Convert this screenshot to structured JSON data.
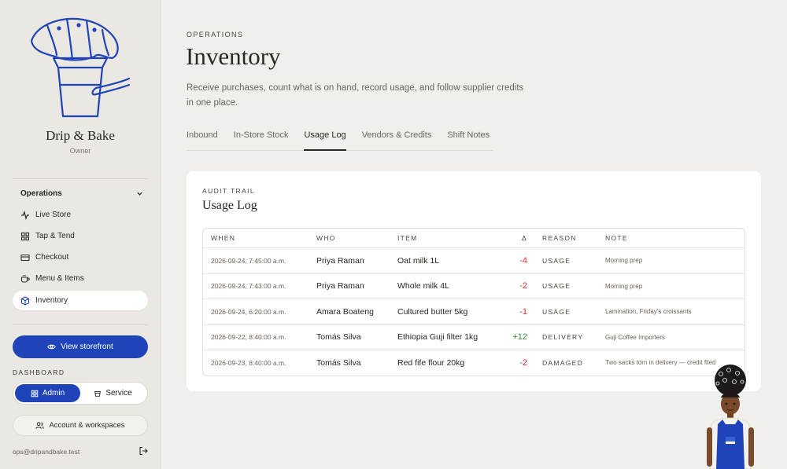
{
  "sidebar": {
    "brand": "Drip & Bake",
    "role": "Owner",
    "section": "Operations",
    "items": [
      {
        "label": "Live Store",
        "icon": "activity-icon"
      },
      {
        "label": "Tap & Tend",
        "icon": "grid-icon"
      },
      {
        "label": "Checkout",
        "icon": "card-icon"
      },
      {
        "label": "Menu & Items",
        "icon": "cup-icon"
      },
      {
        "label": "Inventory",
        "icon": "box-icon",
        "active": true
      }
    ],
    "storefront_label": "View storefront",
    "dashboard_label": "DASHBOARD",
    "toggle": {
      "admin": "Admin",
      "service": "Service",
      "selected": "Admin"
    },
    "account_label": "Account & workspaces",
    "email": "ops@dripandbake.test"
  },
  "header": {
    "eyebrow": "OPERATIONS",
    "title": "Inventory",
    "subtitle": "Receive purchases, count what is on hand, record usage, and follow supplier credits in one place."
  },
  "tabs": [
    {
      "label": "Inbound"
    },
    {
      "label": "In-Store Stock"
    },
    {
      "label": "Usage Log",
      "active": true
    },
    {
      "label": "Vendors & Credits"
    },
    {
      "label": "Shift Notes"
    }
  ],
  "card": {
    "eyebrow": "AUDIT TRAIL",
    "title": "Usage Log",
    "columns": {
      "when": "WHEN",
      "who": "WHO",
      "item": "ITEM",
      "delta": "Δ",
      "reason": "REASON",
      "note": "NOTE"
    },
    "rows": [
      {
        "when": "2026-09-24, 7:45:00 a.m.",
        "who": "Priya Raman",
        "item": "Oat milk 1L",
        "delta": "-4",
        "reason": "USAGE",
        "note": "Morning prep"
      },
      {
        "when": "2026-09-24, 7:43:00 a.m.",
        "who": "Priya Raman",
        "item": "Whole milk 4L",
        "delta": "-2",
        "reason": "USAGE",
        "note": "Morning prep"
      },
      {
        "when": "2026-09-24, 6:20:00 a.m.",
        "who": "Amara Boateng",
        "item": "Cultured butter 5kg",
        "delta": "-1",
        "reason": "USAGE",
        "note": "Lamination, Friday's croissants"
      },
      {
        "when": "2026-09-22, 8:40:00 a.m.",
        "who": "Tomás Silva",
        "item": "Ethiopia Guji filter 1kg",
        "delta": "+12",
        "reason": "DELIVERY",
        "note": "Guji Coffee Importers"
      },
      {
        "when": "2026-09-23, 8:40:00 a.m.",
        "who": "Tomás Silva",
        "item": "Red fife flour 20kg",
        "delta": "-2",
        "reason": "DAMAGED",
        "note": "Two sacks torn in delivery — credit filed"
      }
    ]
  },
  "colors": {
    "accent": "#1f44b9",
    "negative": "#d0302b",
    "positive": "#2f8a3c"
  }
}
